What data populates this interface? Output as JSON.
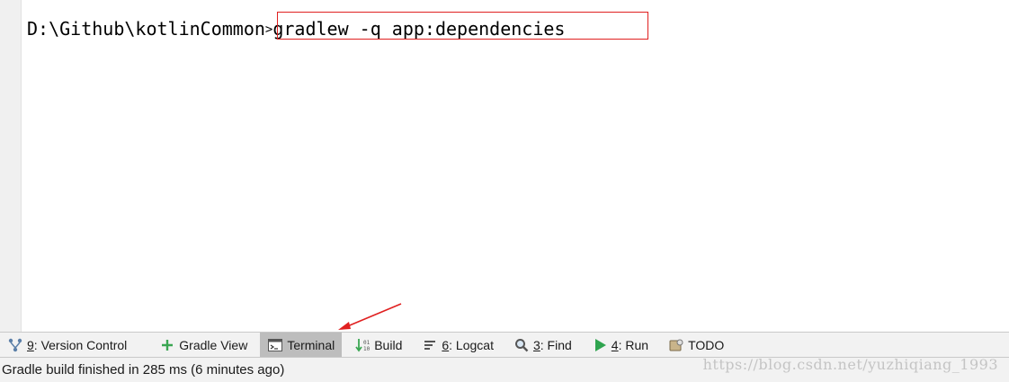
{
  "terminal": {
    "prompt": "D:\\Github\\kotlinCommon",
    "prompt_symbol": ">",
    "command": "gradlew -q app:dependencies"
  },
  "toolbar": {
    "items": [
      {
        "key": "9",
        "label": ": Version Control",
        "icon": "version-control-icon"
      },
      {
        "key": "",
        "label": "Gradle View",
        "icon": "plus-icon"
      },
      {
        "key": "",
        "label": "Terminal",
        "icon": "terminal-icon",
        "active": true
      },
      {
        "key": "",
        "label": "Build",
        "icon": "build-icon"
      },
      {
        "key": "6",
        "label": ": Logcat",
        "icon": "logcat-icon"
      },
      {
        "key": "3",
        "label": ": Find",
        "icon": "search-icon"
      },
      {
        "key": "4",
        "label": ": Run",
        "icon": "play-icon"
      },
      {
        "key": "",
        "label": "TODO",
        "icon": "todo-icon"
      }
    ]
  },
  "status": {
    "message": "Gradle build finished in 285 ms (6 minutes ago)"
  },
  "watermark": "https://blog.csdn.net/yuzhiqiang_1993",
  "colors": {
    "highlight": "#e02020",
    "active_tab": "#bdbdbd",
    "run_green": "#2fa44f"
  }
}
